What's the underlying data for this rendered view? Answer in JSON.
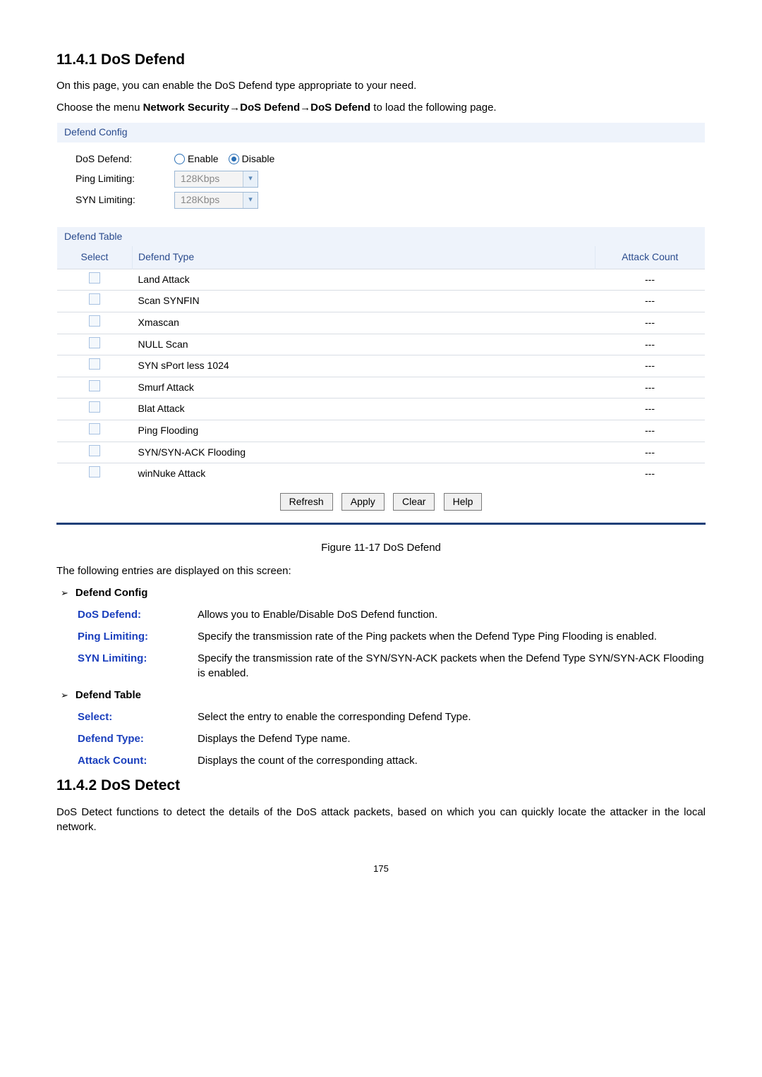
{
  "sections": {
    "dos_defend": {
      "heading": "11.4.1  DoS Defend",
      "intro": "On this page, you can enable the DoS Defend type appropriate to your need.",
      "menu_line_prefix": "Choose the menu ",
      "menu_line_bold": "Network Security→DoS Defend→DoS Defend",
      "menu_line_suffix": " to load the following page."
    },
    "dos_detect": {
      "heading": "11.4.2  DoS Detect",
      "body": "DoS Detect functions to detect the details of the DoS attack packets, based on which you can quickly locate the attacker in the local network."
    }
  },
  "panel": {
    "config_title": "Defend Config",
    "table_title": "Defend Table",
    "labels": {
      "dos_defend": "DoS Defend:",
      "ping_limiting": "Ping Limiting:",
      "syn_limiting": "SYN Limiting:"
    },
    "options": {
      "enable": "Enable",
      "disable": "Disable"
    },
    "dropdowns": {
      "ping": "128Kbps",
      "syn": "128Kbps"
    },
    "columns": {
      "select": "Select",
      "defend_type": "Defend Type",
      "attack_count": "Attack Count"
    },
    "rows": [
      {
        "type": "Land Attack",
        "count": "---"
      },
      {
        "type": "Scan SYNFIN",
        "count": "---"
      },
      {
        "type": "Xmascan",
        "count": "---"
      },
      {
        "type": "NULL Scan",
        "count": "---"
      },
      {
        "type": "SYN sPort less 1024",
        "count": "---"
      },
      {
        "type": "Smurf Attack",
        "count": "---"
      },
      {
        "type": "Blat Attack",
        "count": "---"
      },
      {
        "type": "Ping Flooding",
        "count": "---"
      },
      {
        "type": "SYN/SYN-ACK Flooding",
        "count": "---"
      },
      {
        "type": "winNuke Attack",
        "count": "---"
      }
    ],
    "buttons": {
      "refresh": "Refresh",
      "apply": "Apply",
      "clear": "Clear",
      "help": "Help"
    }
  },
  "figure_caption": "Figure 11-17 DoS Defend",
  "screen_intro": "The following entries are displayed on this screen:",
  "sublists": {
    "defend_config": "Defend Config",
    "defend_table": "Defend Table"
  },
  "definitions": {
    "config": [
      {
        "term": "DoS Defend:",
        "desc": "Allows you to Enable/Disable DoS Defend function."
      },
      {
        "term": "Ping Limiting:",
        "desc": "Specify the transmission rate of the Ping packets when the Defend Type Ping Flooding is enabled."
      },
      {
        "term": "SYN Limiting:",
        "desc": "Specify the transmission rate of the SYN/SYN-ACK packets when the Defend Type SYN/SYN-ACK Flooding is enabled."
      }
    ],
    "table": [
      {
        "term": "Select:",
        "desc": "Select the entry to enable the corresponding Defend Type."
      },
      {
        "term": "Defend Type:",
        "desc": "Displays the Defend Type name."
      },
      {
        "term": "Attack Count:",
        "desc": "Displays the count of the corresponding attack."
      }
    ]
  },
  "page_number": "175"
}
